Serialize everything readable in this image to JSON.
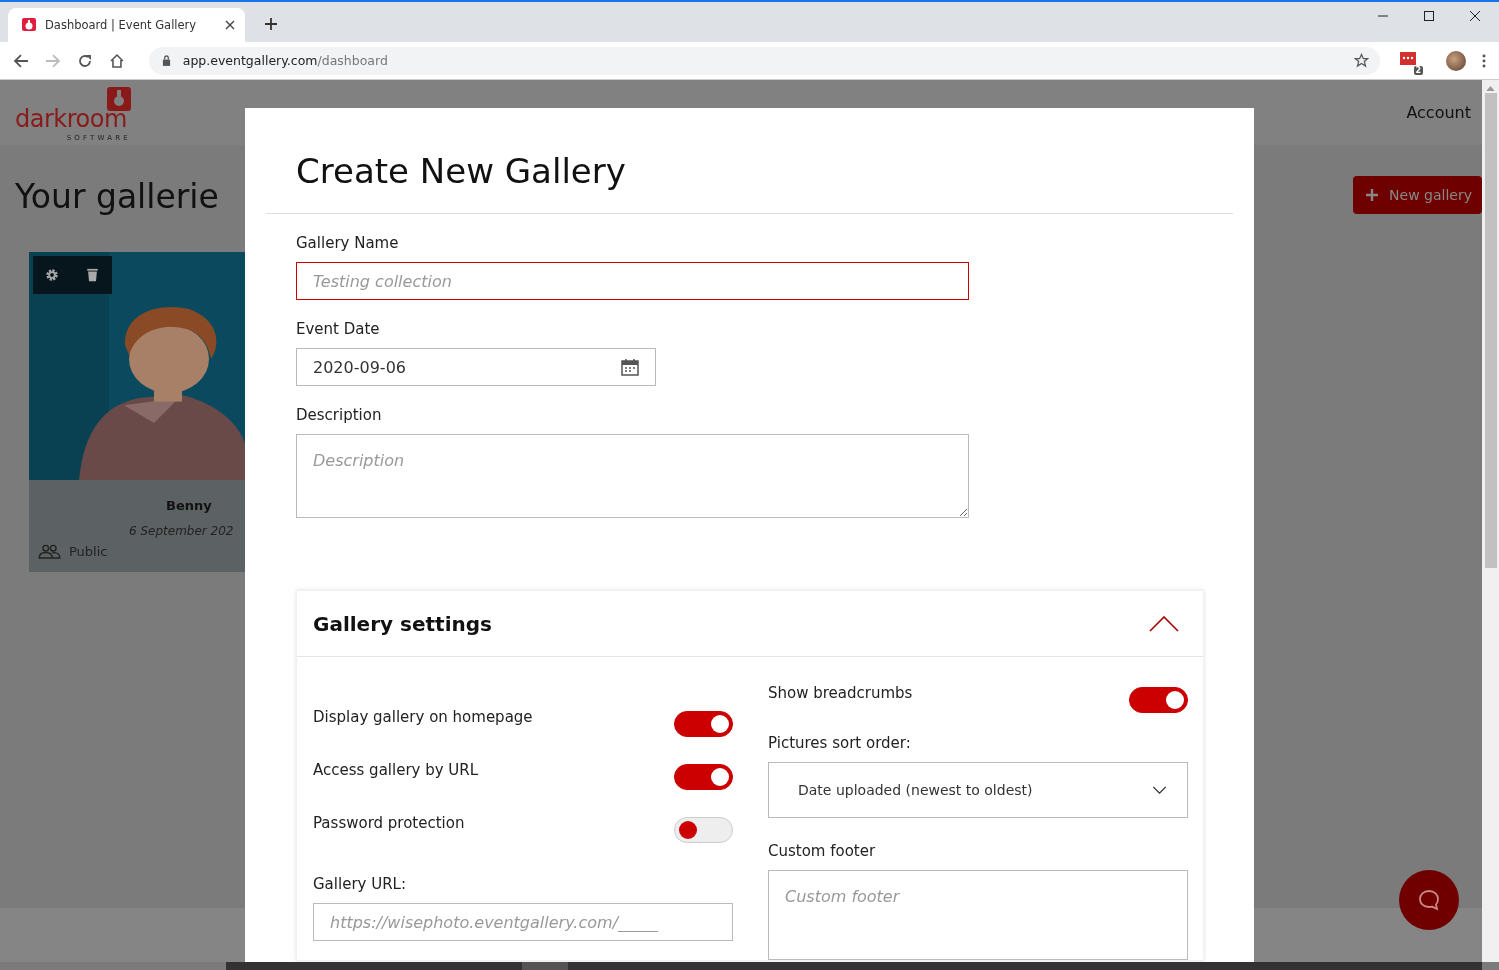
{
  "browser": {
    "tab_title": "Dashboard | Event Gallery",
    "url_host": "app.eventgallery.com",
    "url_path": "/dashboard",
    "extension_badge": "2"
  },
  "page": {
    "logo_word": "darkroom",
    "logo_sub": "SOFTWARE",
    "account": "Account",
    "heading": "Your gallerie",
    "new_gallery_button": "New gallery",
    "card": {
      "name": "Benny",
      "date": "6 September 202",
      "visibility": "Public"
    }
  },
  "modal": {
    "title": "Create New Gallery",
    "gallery_name": {
      "label": "Gallery Name",
      "placeholder": "Testing collection",
      "invalid": true
    },
    "event_date": {
      "label": "Event Date",
      "value": "2020-09-06"
    },
    "description": {
      "label": "Description",
      "placeholder": "Description"
    },
    "settings": {
      "title": "Gallery settings",
      "expanded": true,
      "left_toggles": [
        {
          "label": "Display gallery on homepage",
          "on": true
        },
        {
          "label": "Access gallery by URL",
          "on": true
        },
        {
          "label": "Password protection",
          "on": false
        }
      ],
      "gallery_url": {
        "label": "Gallery URL:",
        "placeholder": "https://wisephoto.eventgallery.com/_____"
      },
      "right_toggles": [
        {
          "label": "Show breadcrumbs",
          "on": true
        }
      ],
      "sort_order": {
        "label": "Pictures sort order:",
        "value": "Date uploaded (newest to oldest)"
      },
      "custom_footer": {
        "label": "Custom footer",
        "placeholder": "Custom footer"
      }
    }
  }
}
